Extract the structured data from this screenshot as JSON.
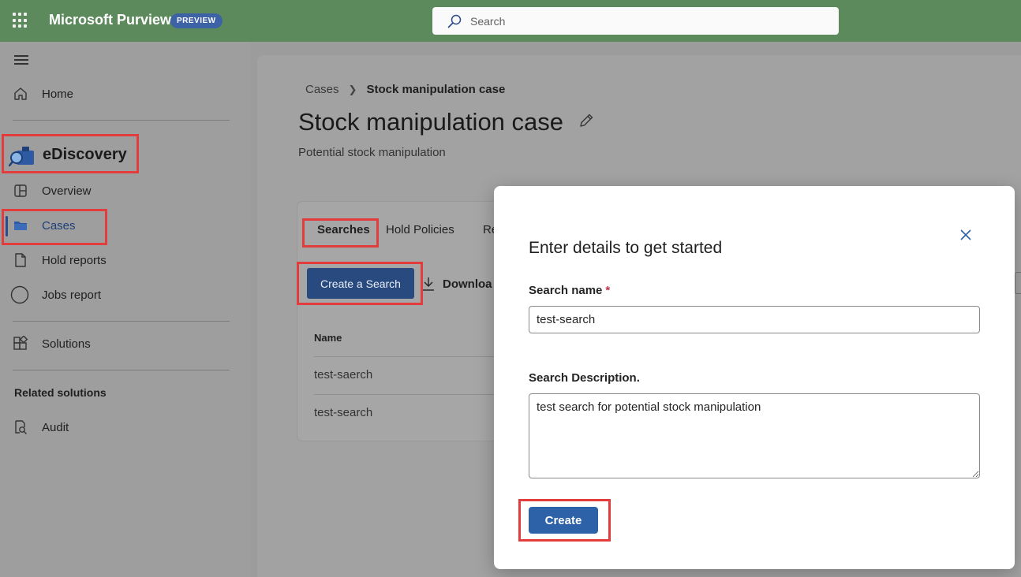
{
  "topbar": {
    "app_name": "Microsoft Purview",
    "badge": "PREVIEW",
    "search_placeholder": "Search"
  },
  "sidebar": {
    "home": "Home",
    "section_title": "eDiscovery",
    "items": [
      {
        "label": "Overview"
      },
      {
        "label": "Cases"
      },
      {
        "label": "Hold reports"
      },
      {
        "label": "Jobs report"
      }
    ],
    "solutions": "Solutions",
    "related_heading": "Related solutions",
    "audit": "Audit"
  },
  "main": {
    "breadcrumb": {
      "root": "Cases",
      "current": "Stock manipulation case"
    },
    "title": "Stock manipulation case",
    "description": "Potential stock manipulation",
    "tabs": [
      {
        "label": "Searches"
      },
      {
        "label": "Hold Policies"
      },
      {
        "label": "Re"
      }
    ],
    "create_button": "Create a Search",
    "download_label": "Downloa",
    "table": {
      "column": "Name",
      "rows": [
        "test-saerch",
        "test-search"
      ]
    }
  },
  "dialog": {
    "title": "Enter details to get started",
    "name_label": "Search name",
    "required_mark": "*",
    "name_value": "test-search",
    "description_label": "Search Description.",
    "description_value": "test search for potential stock manipulation",
    "submit_label": "Create"
  },
  "colors": {
    "topbar": "#5d8a5c",
    "primary_button": "#2e62a8",
    "highlight_box": "#e23c3c"
  }
}
